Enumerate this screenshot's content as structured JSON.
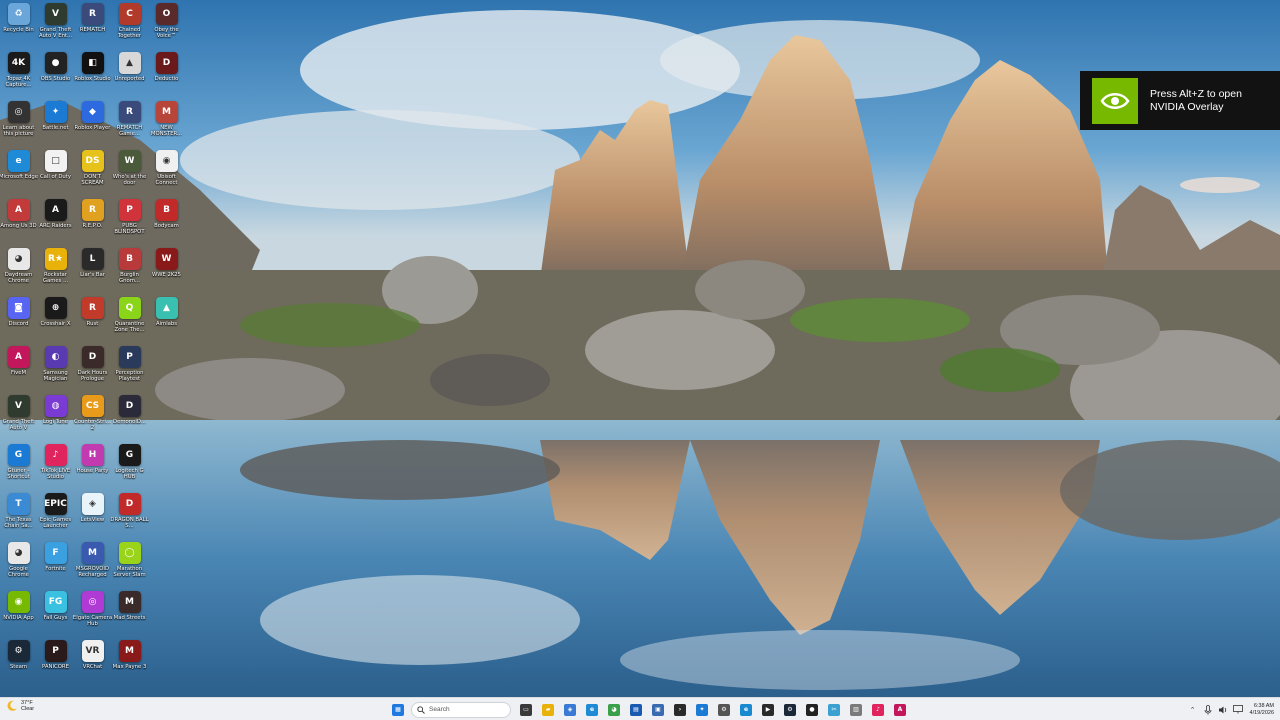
{
  "desktop": {
    "icons": [
      {
        "label": "Recycle Bin",
        "icon": "recycle-bin-icon",
        "color": "#6aa6d9",
        "glyph": "♻"
      },
      {
        "label": "Grand Theft Auto V Ent...",
        "icon": "gta-icon",
        "color": "#2e3b2e",
        "glyph": "V"
      },
      {
        "label": "REMATCH",
        "icon": "rematch-icon",
        "color": "#3a4a7a",
        "glyph": "R"
      },
      {
        "label": "Chained Together",
        "icon": "chained-together-icon",
        "color": "#b23a2a",
        "glyph": "C"
      },
      {
        "label": "Obey the Voice™",
        "icon": "obey-the-voice-icon",
        "color": "#5a2a2a",
        "glyph": "O"
      },
      {
        "label": "Topaz 4K Capture...",
        "icon": "4k-capture-icon",
        "color": "#1b1b1b",
        "glyph": "4K"
      },
      {
        "label": "OBS Studio",
        "icon": "obs-studio-icon",
        "color": "#222222",
        "glyph": "●"
      },
      {
        "label": "Roblox Studio",
        "icon": "roblox-studio-icon",
        "color": "#111111",
        "glyph": "◧"
      },
      {
        "label": "Unreported",
        "icon": "unreported-icon",
        "color": "#d8d8d8",
        "glyph": "▲"
      },
      {
        "label": "Deductio",
        "icon": "deductio-icon",
        "color": "#6a1a1a",
        "glyph": "D"
      },
      {
        "label": "Learn about this picture",
        "icon": "spotlight-icon",
        "color": "#333333",
        "glyph": "◎"
      },
      {
        "label": "Battle.net",
        "icon": "battle-net-icon",
        "color": "#1a7ad4",
        "glyph": "✦"
      },
      {
        "label": "Roblox Player",
        "icon": "roblox-player-icon",
        "color": "#2d6ae0",
        "glyph": "◆"
      },
      {
        "label": "REMATCH Game...",
        "icon": "rematch-game-icon",
        "color": "#3a4a7a",
        "glyph": "R"
      },
      {
        "label": "NEW MONSTER...",
        "icon": "monster-icon",
        "color": "#b8453a",
        "glyph": "M"
      },
      {
        "label": "Microsoft Edge",
        "icon": "edge-icon",
        "color": "#1f8ad6",
        "glyph": "e"
      },
      {
        "label": "Call of Duty",
        "icon": "call-of-duty-icon",
        "color": "#f2f2f2",
        "glyph": "□"
      },
      {
        "label": "DON'T SCREAM",
        "icon": "dont-scream-icon",
        "color": "#e6c21a",
        "glyph": "DS"
      },
      {
        "label": "Who's at the door",
        "icon": "whos-at-the-door-icon",
        "color": "#4a5a3a",
        "glyph": "W"
      },
      {
        "label": "Ubisoft Connect",
        "icon": "ubisoft-connect-icon",
        "color": "#f0f0f0",
        "glyph": "◉"
      },
      {
        "label": "Among Us 3D",
        "icon": "among-us-icon",
        "color": "#c23a3a",
        "glyph": "A"
      },
      {
        "label": "ARC Raiders",
        "icon": "arc-raiders-icon",
        "color": "#1a1a1a",
        "glyph": "A"
      },
      {
        "label": "R.E.P.O.",
        "icon": "repo-icon",
        "color": "#e0a020",
        "glyph": "R"
      },
      {
        "label": "PUBG BLINDSPOT",
        "icon": "pubg-blindspot-icon",
        "color": "#d0343a",
        "glyph": "P"
      },
      {
        "label": "Bodycam",
        "icon": "bodycam-icon",
        "color": "#c22a2a",
        "glyph": "B"
      },
      {
        "label": "Daydream Chrome",
        "icon": "chrome-alt-icon",
        "color": "#e8e8e8",
        "glyph": "◕"
      },
      {
        "label": "Rockstar Games ...",
        "icon": "rockstar-games-icon",
        "color": "#e8b20a",
        "glyph": "R★"
      },
      {
        "label": "Liar's Bar",
        "icon": "liars-bar-icon",
        "color": "#2a2a2a",
        "glyph": "L"
      },
      {
        "label": "Burglin Gnom...",
        "icon": "burglin-gnomes-icon",
        "color": "#b83a3a",
        "glyph": "B"
      },
      {
        "label": "WWE 2K25",
        "icon": "wwe-2k25-icon",
        "color": "#8a1a1a",
        "glyph": "W"
      },
      {
        "label": "Discord",
        "icon": "discord-icon",
        "color": "#5865f2",
        "glyph": "◙"
      },
      {
        "label": "Crosshair X",
        "icon": "crosshair-x-icon",
        "color": "#1a1a1a",
        "glyph": "⊕"
      },
      {
        "label": "Rust",
        "icon": "rust-icon",
        "color": "#c23a2a",
        "glyph": "R"
      },
      {
        "label": "Quarantine Zone The...",
        "icon": "quarantine-zone-icon",
        "color": "#8ad41a",
        "glyph": "Q"
      },
      {
        "label": "Aimlabs",
        "icon": "aimlabs-icon",
        "color": "#3ac0b0",
        "glyph": "▲"
      },
      {
        "label": "FiveM",
        "icon": "fivem-icon",
        "color": "#c2185b",
        "glyph": "A"
      },
      {
        "label": "Samsung Magician",
        "icon": "samsung-magician-icon",
        "color": "#5a3ab0",
        "glyph": "◐"
      },
      {
        "label": "Dark Hours Prologue",
        "icon": "dark-hours-icon",
        "color": "#3a2a2a",
        "glyph": "D"
      },
      {
        "label": "Perception Playtest",
        "icon": "perception-icon",
        "color": "#2a3a5a",
        "glyph": "P"
      },
      {
        "label": "",
        "icon": "blank-icon",
        "color": "transparent",
        "glyph": ""
      },
      {
        "label": "Grand Theft Auto V",
        "icon": "gta-v-icon",
        "color": "#2e3b2e",
        "glyph": "V"
      },
      {
        "label": "Logi Tune",
        "icon": "logi-tune-icon",
        "color": "#7a3ad4",
        "glyph": "◍"
      },
      {
        "label": "Counter-Stri... 2",
        "icon": "counter-strike-icon",
        "color": "#e89a1a",
        "glyph": "CS"
      },
      {
        "label": "DemonolD...",
        "icon": "demonologist-icon",
        "color": "#2a2a3a",
        "glyph": "D"
      },
      {
        "label": "",
        "icon": "blank-icon",
        "color": "transparent",
        "glyph": ""
      },
      {
        "label": "Gtuner - Shortcut",
        "icon": "gtuner-icon",
        "color": "#1a7ad4",
        "glyph": "G"
      },
      {
        "label": "TikTok LIVE Studio",
        "icon": "tiktok-live-icon",
        "color": "#e0245e",
        "glyph": "♪"
      },
      {
        "label": "House Party",
        "icon": "house-party-icon",
        "color": "#c23ab0",
        "glyph": "H"
      },
      {
        "label": "Logitech G HUB",
        "icon": "logitech-ghub-icon",
        "color": "#1a1a1a",
        "glyph": "G"
      },
      {
        "label": "",
        "icon": "blank-icon",
        "color": "transparent",
        "glyph": ""
      },
      {
        "label": "The Texas Chain Sa...",
        "icon": "texas-chain-saw-icon",
        "color": "#3a8ad4",
        "glyph": "T"
      },
      {
        "label": "Epic Games Launcher",
        "icon": "epic-games-icon",
        "color": "#1a1a1a",
        "glyph": "EPIC"
      },
      {
        "label": "LetsView",
        "icon": "letsview-icon",
        "color": "#e8f4fa",
        "glyph": "◈"
      },
      {
        "label": "DRAGON BALL S...",
        "icon": "dragon-ball-icon",
        "color": "#c22a2a",
        "glyph": "D"
      },
      {
        "label": "",
        "icon": "blank-icon",
        "color": "transparent",
        "glyph": ""
      },
      {
        "label": "Google Chrome",
        "icon": "chrome-icon",
        "color": "#e8e8e8",
        "glyph": "◕"
      },
      {
        "label": "Fortnite",
        "icon": "fortnite-icon",
        "color": "#3aa0e0",
        "glyph": "F"
      },
      {
        "label": "MSGROVOID Recharged",
        "icon": "msgrovoid-icon",
        "color": "#3a5ab0",
        "glyph": "M"
      },
      {
        "label": "Marathon Server Slam",
        "icon": "marathon-icon",
        "color": "#9ad41a",
        "glyph": "◯"
      },
      {
        "label": "",
        "icon": "blank-icon",
        "color": "transparent",
        "glyph": ""
      },
      {
        "label": "NVIDIA App",
        "icon": "nvidia-app-icon",
        "color": "#76b900",
        "glyph": "◉"
      },
      {
        "label": "Fall Guys",
        "icon": "fall-guys-icon",
        "color": "#3ac0e0",
        "glyph": "FG"
      },
      {
        "label": "Elgato Camera Hub",
        "icon": "elgato-camera-hub-icon",
        "color": "#b03ad4",
        "glyph": "◎"
      },
      {
        "label": "Mad Streets",
        "icon": "mad-streets-icon",
        "color": "#3a2a2a",
        "glyph": "M"
      },
      {
        "label": "",
        "icon": "blank-icon",
        "color": "transparent",
        "glyph": ""
      },
      {
        "label": "Steam",
        "icon": "steam-icon",
        "color": "#1b2838",
        "glyph": "⚙"
      },
      {
        "label": "PANICORE",
        "icon": "panicore-icon",
        "color": "#2a1a1a",
        "glyph": "P"
      },
      {
        "label": "VRChat",
        "icon": "vrchat-icon",
        "color": "#f0f0f0",
        "glyph": "VR"
      },
      {
        "label": "Max Payne 3",
        "icon": "max-payne-3-icon",
        "color": "#8a1a1a",
        "glyph": "M"
      }
    ]
  },
  "nvidia_toast": {
    "line1": "Press Alt+Z to open",
    "line2": "NVIDIA Overlay",
    "brand_color": "#76b900"
  },
  "taskbar": {
    "weather": {
      "temp": "37°F",
      "condition": "Clear"
    },
    "search_placeholder": "Search",
    "pinned": [
      {
        "icon": "start-icon",
        "color": "#1f7ae0",
        "glyph": "▦"
      },
      {
        "icon": "search-pill",
        "color": "",
        "glyph": ""
      },
      {
        "icon": "task-view-icon",
        "color": "#3a3a3a",
        "glyph": "▭"
      },
      {
        "icon": "file-explorer-icon",
        "color": "#e8b20a",
        "glyph": "▰"
      },
      {
        "icon": "copilot-icon",
        "color": "#3a7ad4",
        "glyph": "◈"
      },
      {
        "icon": "edge-icon",
        "color": "#1f8ad6",
        "glyph": "e"
      },
      {
        "icon": "chrome-icon",
        "color": "#3aa04a",
        "glyph": "◕"
      },
      {
        "icon": "notepad-icon",
        "color": "#1a5ab0",
        "glyph": "▤"
      },
      {
        "icon": "photos-icon",
        "color": "#3a6ab0",
        "glyph": "▣"
      },
      {
        "icon": "terminal-icon",
        "color": "#2a2a2a",
        "glyph": "›"
      },
      {
        "icon": "battle-net-icon",
        "color": "#1a7ad4",
        "glyph": "✦"
      },
      {
        "icon": "settings-icon",
        "color": "#555555",
        "glyph": "⚙"
      },
      {
        "icon": "edge-beta-icon",
        "color": "#1a8ad0",
        "glyph": "e"
      },
      {
        "icon": "media-icon",
        "color": "#2a2a2a",
        "glyph": "▶"
      },
      {
        "icon": "steam-icon",
        "color": "#1b2838",
        "glyph": "⚙"
      },
      {
        "icon": "obs-studio-icon",
        "color": "#222222",
        "glyph": "●"
      },
      {
        "icon": "snipping-tool-icon",
        "color": "#3aa0d0",
        "glyph": "✂"
      },
      {
        "icon": "paint-icon",
        "color": "#7a7a7a",
        "glyph": "▥"
      },
      {
        "icon": "tiktok-live-icon",
        "color": "#e0245e",
        "glyph": "♪"
      },
      {
        "icon": "fivem-icon",
        "color": "#c2185b",
        "glyph": "A"
      }
    ],
    "tray": {
      "clock_time": "6:38 AM",
      "clock_date": "4/19/2026"
    }
  }
}
